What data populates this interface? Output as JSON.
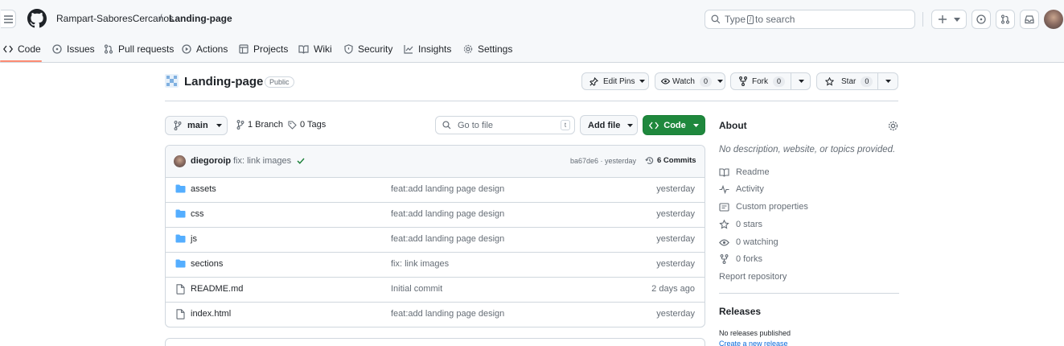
{
  "header": {
    "owner": "Rampart-SaboresCercanos",
    "separator": "/",
    "repo": "Landing-page",
    "search_prefix": "Type",
    "search_key": "/",
    "search_suffix": "to search"
  },
  "nav": {
    "code": "Code",
    "issues": "Issues",
    "pulls": "Pull requests",
    "actions": "Actions",
    "projects": "Projects",
    "wiki": "Wiki",
    "security": "Security",
    "insights": "Insights",
    "settings": "Settings"
  },
  "repo": {
    "title": "Landing-page",
    "visibility": "Public",
    "edit_pins": "Edit Pins",
    "watch": "Watch",
    "watch_count": "0",
    "fork": "Fork",
    "fork_count": "0",
    "star": "Star",
    "star_count": "0"
  },
  "controls": {
    "branch": "main",
    "branches": "1 Branch",
    "tags": "0 Tags",
    "goto_placeholder": "Go to file",
    "goto_key": "t",
    "add_file": "Add file",
    "code": "Code"
  },
  "commit": {
    "author": "diegoroip",
    "message": "fix: link images",
    "hash_time": "ba67de6 · yesterday",
    "commits": "6 Commits"
  },
  "files": [
    {
      "name": "assets",
      "type": "folder",
      "message": "feat:add landing page design",
      "date": "yesterday"
    },
    {
      "name": "css",
      "type": "folder",
      "message": "feat:add landing page design",
      "date": "yesterday"
    },
    {
      "name": "js",
      "type": "folder",
      "message": "feat:add landing page design",
      "date": "yesterday"
    },
    {
      "name": "sections",
      "type": "folder",
      "message": "fix: link images",
      "date": "yesterday"
    },
    {
      "name": "README.md",
      "type": "file",
      "message": "Initial commit",
      "date": "2 days ago"
    },
    {
      "name": "index.html",
      "type": "file",
      "message": "feat:add landing page design",
      "date": "yesterday"
    }
  ],
  "about": {
    "title": "About",
    "description": "No description, website, or topics provided.",
    "readme": "Readme",
    "activity": "Activity",
    "custom_properties": "Custom properties",
    "stars": "0 stars",
    "watching": "0 watching",
    "forks": "0 forks",
    "report": "Report repository"
  },
  "releases": {
    "title": "Releases",
    "none": "No releases published",
    "create": "Create a new release"
  },
  "colors": {
    "accent_green": "#1f883d",
    "nav_underline": "#fd8c73",
    "folder_blue": "#54aeff",
    "link_blue": "#0969da",
    "check_green": "#1a7f37"
  }
}
